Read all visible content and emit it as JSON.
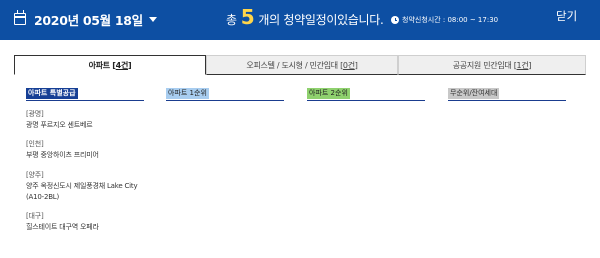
{
  "header": {
    "date": "2020년 05월 18일",
    "summary_prefix": "총",
    "summary_count": "5",
    "summary_suffix": "개의 청약일정이있습니다.",
    "hours": "청약신청시간 : 08:00 ~ 17:30",
    "close_label": "닫기"
  },
  "tabs": [
    {
      "label": "아파트 [",
      "count": "4건",
      "end": "]",
      "active": true
    },
    {
      "label": "오피스텔 / 도시형 / 민간임대 [",
      "count": "0건",
      "end": "]",
      "active": false
    },
    {
      "label": "공공지원 민간임대 [",
      "count": "1건",
      "end": "]",
      "active": false
    }
  ],
  "columns": [
    {
      "title": "아파트 특별공급"
    },
    {
      "title": "아파트 1순위"
    },
    {
      "title": "아파트 2순위"
    },
    {
      "title": "무순위/잔여세대"
    }
  ],
  "entries": [
    {
      "region": "[광명]",
      "name": "광명 푸르지오 센트베르"
    },
    {
      "region": "[인천]",
      "name": "부평 중앙하이츠 프리미어"
    },
    {
      "region": "[양주]",
      "name": "양주 옥정신도시 제일풍경채 Lake City",
      "name2": "(A10-2BL)"
    },
    {
      "region": "[대구]",
      "name": "힐스테이트 대구역 오페라"
    }
  ],
  "colors": {
    "header_bg": "#0d4fa3",
    "count_highlight": "#ffd54a",
    "special_bg": "#163f95",
    "first_bg": "#a8cdf0",
    "second_bg": "#8fd16e",
    "nosrank_bg": "#c8c8c8"
  }
}
